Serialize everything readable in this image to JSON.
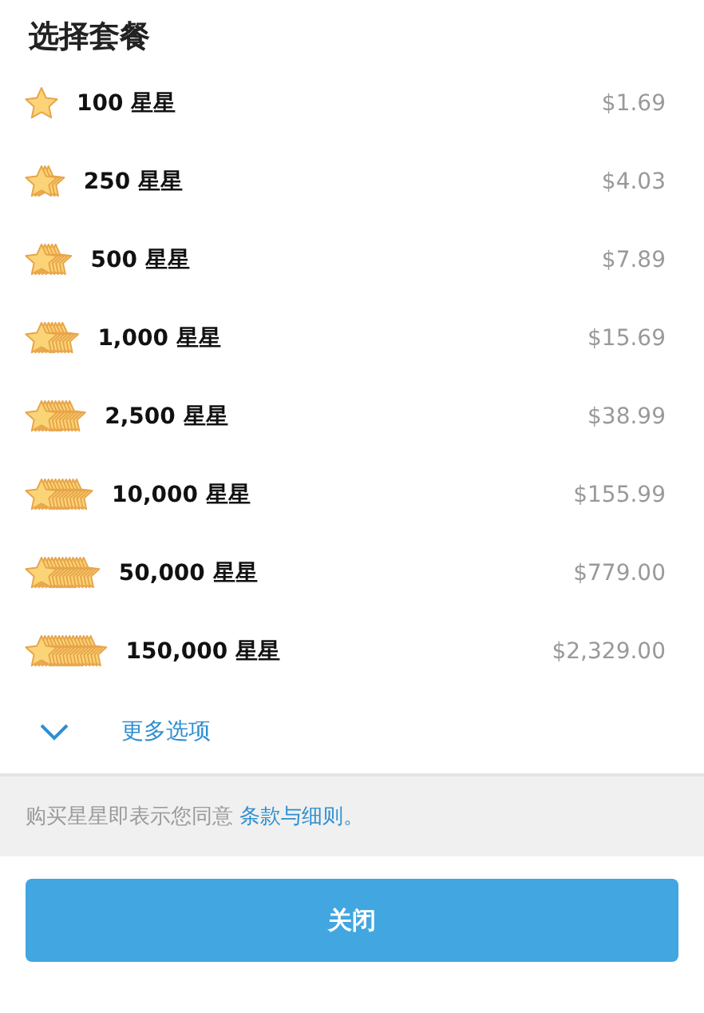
{
  "title": "选择套餐",
  "packages": [
    {
      "label": "100 星星",
      "price": "$1.69"
    },
    {
      "label": "250 星星",
      "price": "$4.03"
    },
    {
      "label": "500 星星",
      "price": "$7.89"
    },
    {
      "label": "1,000 星星",
      "price": "$15.69"
    },
    {
      "label": "2,500 星星",
      "price": "$38.99"
    },
    {
      "label": "10,000 星星",
      "price": "$155.99"
    },
    {
      "label": "50,000 星星",
      "price": "$779.00"
    },
    {
      "label": "150,000 星星",
      "price": "$2,329.00"
    }
  ],
  "more_options": {
    "label": "更多选项",
    "expanded": false
  },
  "terms": {
    "text": "购买星星即表示您同意",
    "link": "条款与细则。"
  },
  "close_button": "关闭"
}
